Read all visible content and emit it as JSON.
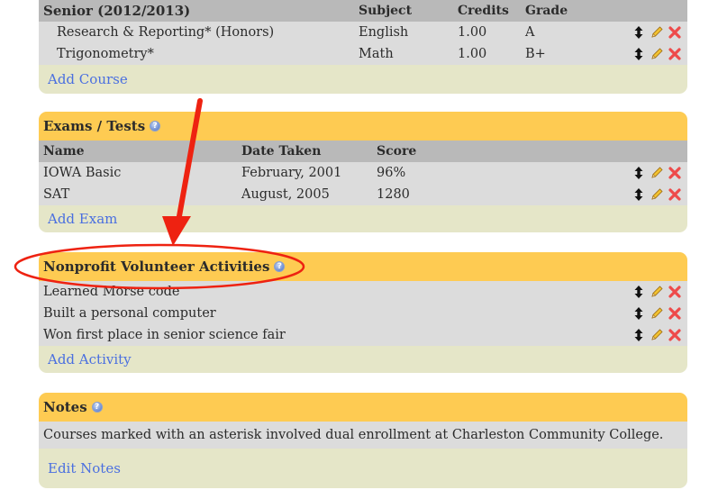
{
  "senior": {
    "headers": {
      "title": "Senior (2012/2013)",
      "subject": "Subject",
      "credits": "Credits",
      "grade": "Grade"
    },
    "courses": [
      {
        "name": "Research & Reporting* (Honors)",
        "subject": "English",
        "credits": "1.00",
        "grade": "A"
      },
      {
        "name": "Trigonometry*",
        "subject": "Math",
        "credits": "1.00",
        "grade": "B+"
      }
    ],
    "add_label": "Add Course"
  },
  "exams": {
    "title": "Exams / Tests",
    "help": "?",
    "headers": {
      "name": "Name",
      "date": "Date Taken",
      "score": "Score"
    },
    "rows": [
      {
        "name": "IOWA Basic",
        "date": "February, 2001",
        "score": "96%"
      },
      {
        "name": "SAT",
        "date": "August, 2005",
        "score": "1280"
      }
    ],
    "add_label": "Add Exam"
  },
  "activities": {
    "title": "Nonprofit Volunteer Activities",
    "help": "?",
    "rows": [
      {
        "name": "Learned Morse code"
      },
      {
        "name": "Built a personal computer"
      },
      {
        "name": "Won first place in senior science fair"
      }
    ],
    "add_label": "Add Activity"
  },
  "notes": {
    "title": "Notes",
    "help": "?",
    "text": "Courses marked with an asterisk involved dual enrollment at Charleston Community College.",
    "edit_label": "Edit Notes"
  },
  "icons": {
    "move": "move-icon",
    "edit": "pencil-icon",
    "delete": "delete-icon",
    "help": "help-icon"
  },
  "colors": {
    "header": "#fecb52",
    "column_header": "#b9b9b9",
    "row": "#dcdcdc",
    "footer": "#e5e6c8",
    "link": "#4a6fe0",
    "annotation": "#ee2211"
  }
}
